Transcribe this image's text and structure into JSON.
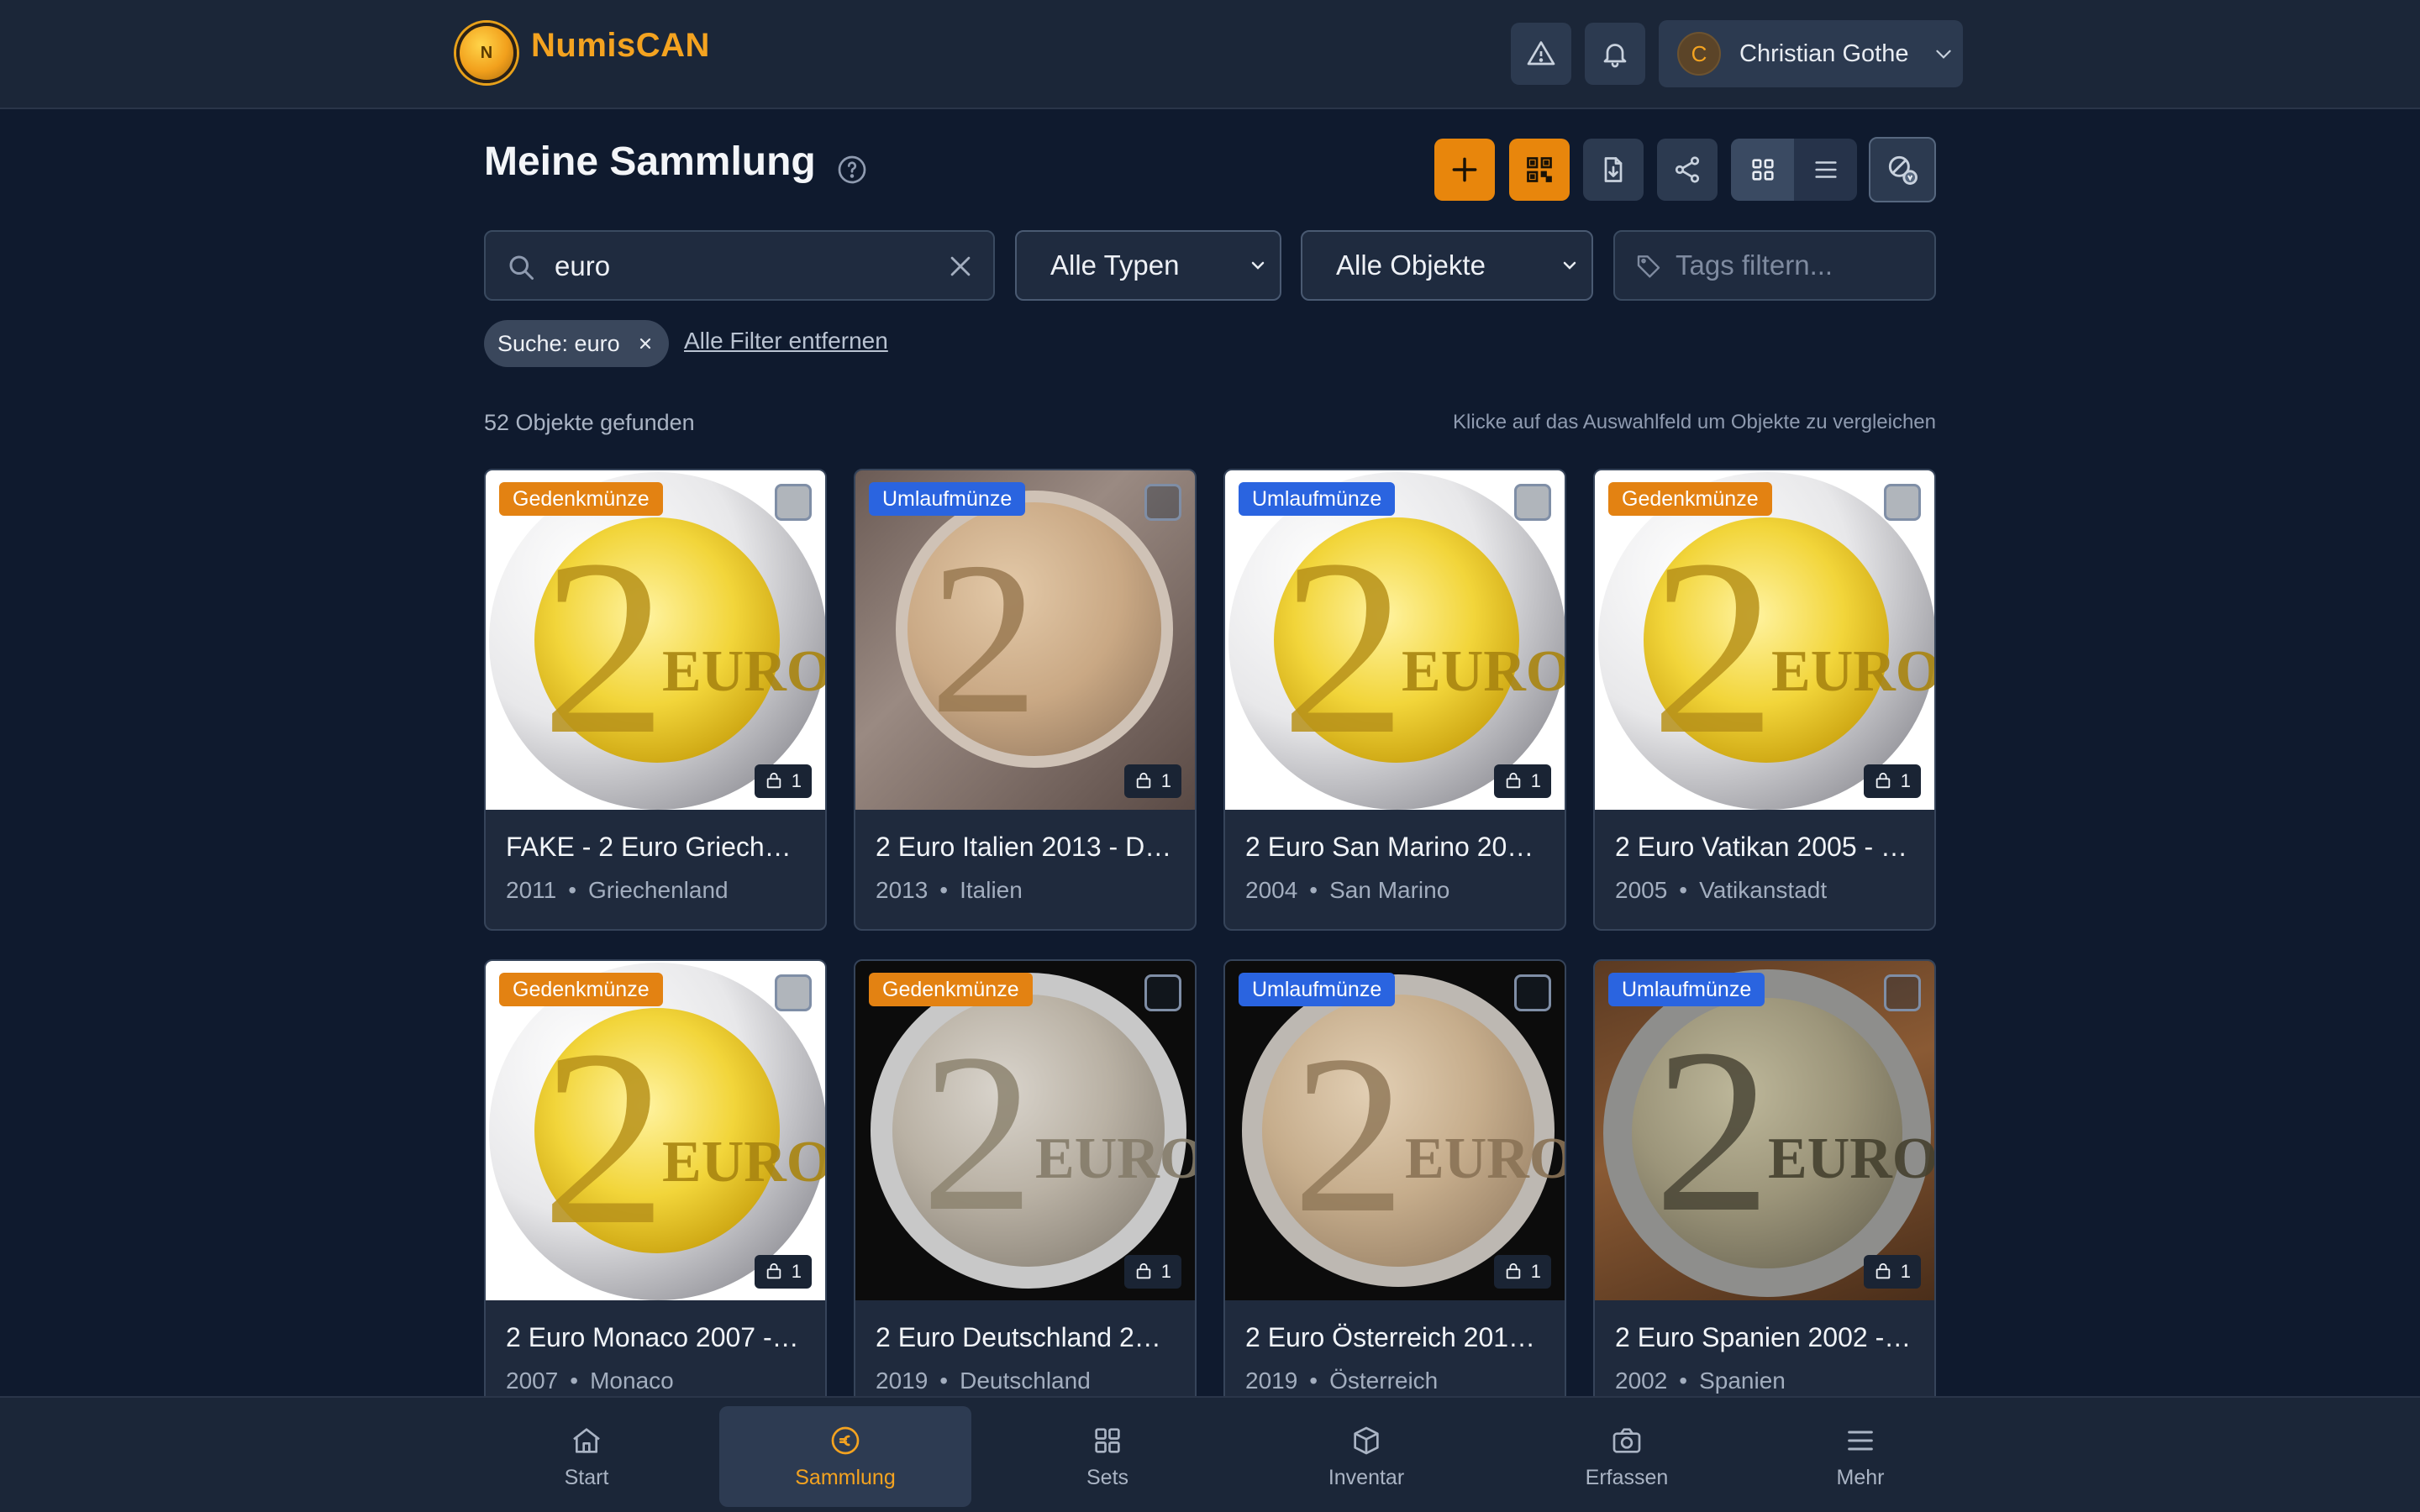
{
  "app": {
    "brand": "NumisCAN",
    "logo_letter": "N"
  },
  "header": {
    "user": {
      "initial": "C",
      "name": "Christian Gothe"
    }
  },
  "page": {
    "title": "Meine Sammlung"
  },
  "filters": {
    "search_value": "euro",
    "type_select": "Alle Typen",
    "object_select": "Alle Objekte",
    "tags_placeholder": "Tags filtern..."
  },
  "active_filters": {
    "chip": "Suche: euro",
    "clear_all": "Alle Filter entfernen"
  },
  "results": {
    "count_text": "52 Objekte gefunden",
    "hint": "Klicke auf das Auswahlfeld um Objekte zu vergleichen"
  },
  "items": [
    {
      "badge": "Gedenkmünze",
      "badge_type": "gedenk",
      "title": "FAKE - 2 Euro Griech…",
      "year": "2011",
      "country": "Griechenland",
      "qty": "1"
    },
    {
      "badge": "Umlaufmünze",
      "badge_type": "umlauf",
      "title": "2 Euro Italien 2013 - D…",
      "year": "2013",
      "country": "Italien",
      "qty": "1"
    },
    {
      "badge": "Umlaufmünze",
      "badge_type": "umlauf",
      "title": "2 Euro San Marino 20…",
      "year": "2004",
      "country": "San Marino",
      "qty": "1"
    },
    {
      "badge": "Gedenkmünze",
      "badge_type": "gedenk",
      "title": "2 Euro Vatikan 2005 - …",
      "year": "2005",
      "country": "Vatikanstadt",
      "qty": "1"
    },
    {
      "badge": "Gedenkmünze",
      "badge_type": "gedenk",
      "title": "2 Euro Monaco 2007 -…",
      "year": "2007",
      "country": "Monaco",
      "qty": "1"
    },
    {
      "badge": "Gedenkmünze",
      "badge_type": "gedenk",
      "title": "2 Euro Deutschland 2…",
      "year": "2019",
      "country": "Deutschland",
      "qty": "1"
    },
    {
      "badge": "Umlaufmünze",
      "badge_type": "umlauf",
      "title": "2 Euro Österreich 201…",
      "year": "2019",
      "country": "Österreich",
      "qty": "1"
    },
    {
      "badge": "Umlaufmünze",
      "badge_type": "umlauf",
      "title": "2 Euro Spanien 2002 -…",
      "year": "2002",
      "country": "Spanien",
      "qty": "1"
    }
  ],
  "coin_art": {
    "denomination": "2",
    "word": "EURO"
  },
  "bottom_nav": [
    {
      "label": "Start",
      "icon": "home-icon"
    },
    {
      "label": "Sammlung",
      "icon": "euro-coin-icon",
      "active": true
    },
    {
      "label": "Sets",
      "icon": "grid-icon"
    },
    {
      "label": "Inventar",
      "icon": "box-icon"
    },
    {
      "label": "Erfassen",
      "icon": "camera-icon"
    },
    {
      "label": "Mehr",
      "icon": "menu-icon"
    }
  ],
  "colors": {
    "accent": "#f4a320",
    "accent_button": "#e8860c",
    "badge_gedenk": "#e38212",
    "badge_umlauf": "#2a64e0",
    "background": "#0f1a2e"
  }
}
